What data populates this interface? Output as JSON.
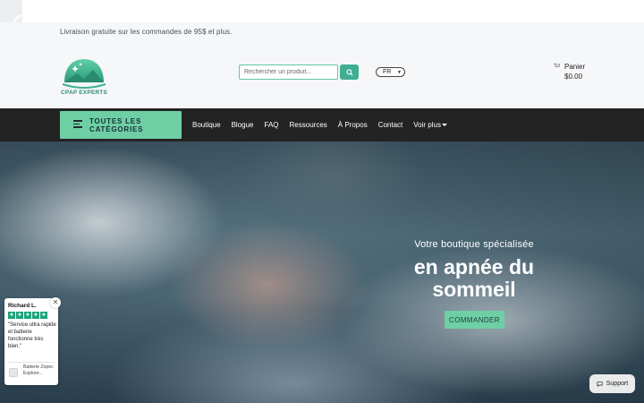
{
  "announcement": {
    "text": "Livraison gratuite sur les commandes de 95$ et plus."
  },
  "logo": {
    "text": "CPAP EXPERTS",
    "colors": {
      "green": "#3fb38f",
      "dark_green": "#2f8f75"
    }
  },
  "search": {
    "placeholder": "Rechercher un produit...",
    "value": "",
    "button_icon": "search-icon"
  },
  "language": {
    "selected": "FR"
  },
  "cart": {
    "label": "Panier",
    "total": "$0.00",
    "icon": "cart-icon"
  },
  "nav": {
    "categories_button": "TOUTES LES CATÉGORIES",
    "items": [
      {
        "label": "Boutique"
      },
      {
        "label": "Blogue"
      },
      {
        "label": "FAQ"
      },
      {
        "label": "Ressources"
      },
      {
        "label": "À Propos"
      },
      {
        "label": "Contact"
      },
      {
        "label": "Voir plus"
      }
    ]
  },
  "hero": {
    "subtitle": "Votre boutique spécialisée",
    "title": "en apnée du sommeil",
    "cta": "COMMANDER"
  },
  "review": {
    "name": "Richard L.",
    "rating": 5,
    "quote": "\"Service ultra rapide et batterie fonctionne très bien.\"",
    "product": "Batterie Zopec Explore..."
  },
  "support": {
    "label": "Support"
  },
  "colors": {
    "accent": "#6fcfa4",
    "nav_bg": "#232323",
    "header_bg": "#f6f7f9",
    "search_btn": "#3fae92",
    "star": "#1aa37a"
  }
}
